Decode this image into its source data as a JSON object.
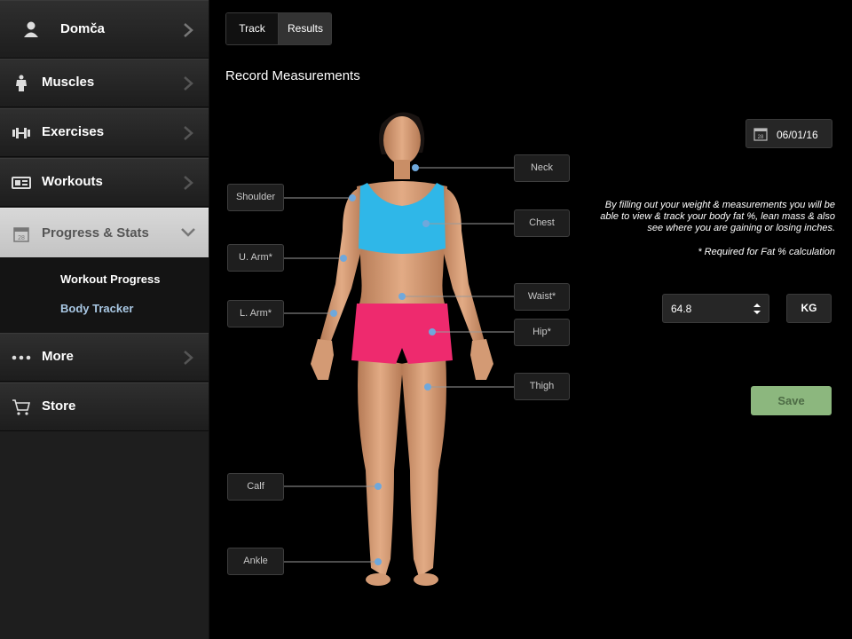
{
  "sidebar": {
    "profile": {
      "name": "Domča",
      "icon": "person-icon"
    },
    "items": [
      {
        "label": "Muscles",
        "icon": "body-icon"
      },
      {
        "label": "Exercises",
        "icon": "dumbbell-icon"
      },
      {
        "label": "Workouts",
        "icon": "workout-card-icon"
      },
      {
        "label": "Progress & Stats",
        "icon": "calendar-icon",
        "expanded": true
      },
      {
        "label": "More",
        "icon": "dots-icon"
      },
      {
        "label": "Store",
        "icon": "cart-icon"
      }
    ],
    "subitems": [
      {
        "label": "Workout Progress",
        "color": "#ffffff"
      },
      {
        "label": "Body Tracker",
        "color": "#a9c8e4"
      }
    ]
  },
  "tabs": [
    "Track",
    "Results"
  ],
  "title": "Record Measurements",
  "markers": [
    {
      "label": "Neck"
    },
    {
      "label": "Shoulder"
    },
    {
      "label": "Chest"
    },
    {
      "label": "U. Arm*"
    },
    {
      "label": "Waist*"
    },
    {
      "label": "L. Arm*"
    },
    {
      "label": "Hip*"
    },
    {
      "label": "Thigh"
    },
    {
      "label": "Calf"
    },
    {
      "label": "Ankle"
    }
  ],
  "date": {
    "value": "06/01/16",
    "day": "28",
    "icon": "calendar-icon"
  },
  "info_text": "By filling out your weight & measurements you will be able to view & track your body fat %, lean mass & also see where you are gaining or losing inches.",
  "required_note": "* Required for Fat % calculation",
  "weight": {
    "value": "64.8",
    "unit": "KG"
  },
  "save_label": "Save",
  "colors": {
    "accent": "#a9c8e4",
    "marker_dot": "#6fa8dc",
    "save_bg": "#8cb77e",
    "top_color": "#2fb7e8",
    "shorts_color": "#ee2a6e"
  }
}
